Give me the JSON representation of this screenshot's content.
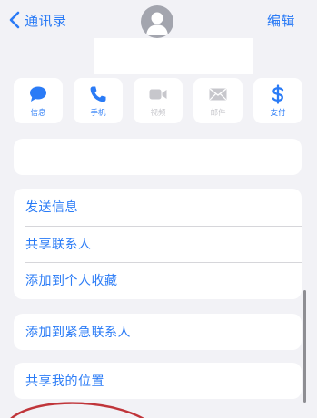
{
  "nav": {
    "back_label": "通讯录",
    "edit_label": "编辑"
  },
  "actions": [
    {
      "label": "信息",
      "icon": "message-icon",
      "enabled": true
    },
    {
      "label": "手机",
      "icon": "phone-icon",
      "enabled": true
    },
    {
      "label": "视频",
      "icon": "video-icon",
      "enabled": false
    },
    {
      "label": "邮件",
      "icon": "mail-icon",
      "enabled": false
    },
    {
      "label": "支付",
      "icon": "dollar-icon",
      "enabled": true
    }
  ],
  "list": {
    "items": [
      "发送信息",
      "共享联系人",
      "添加到个人收藏"
    ]
  },
  "emergency": {
    "label": "添加到紧急联系人"
  },
  "location": {
    "label": "共享我的位置"
  },
  "colors": {
    "accent": "#2a7bf6",
    "disabled": "#c7c7cc",
    "background": "#f2f2f6",
    "annotation": "#c0353a"
  }
}
